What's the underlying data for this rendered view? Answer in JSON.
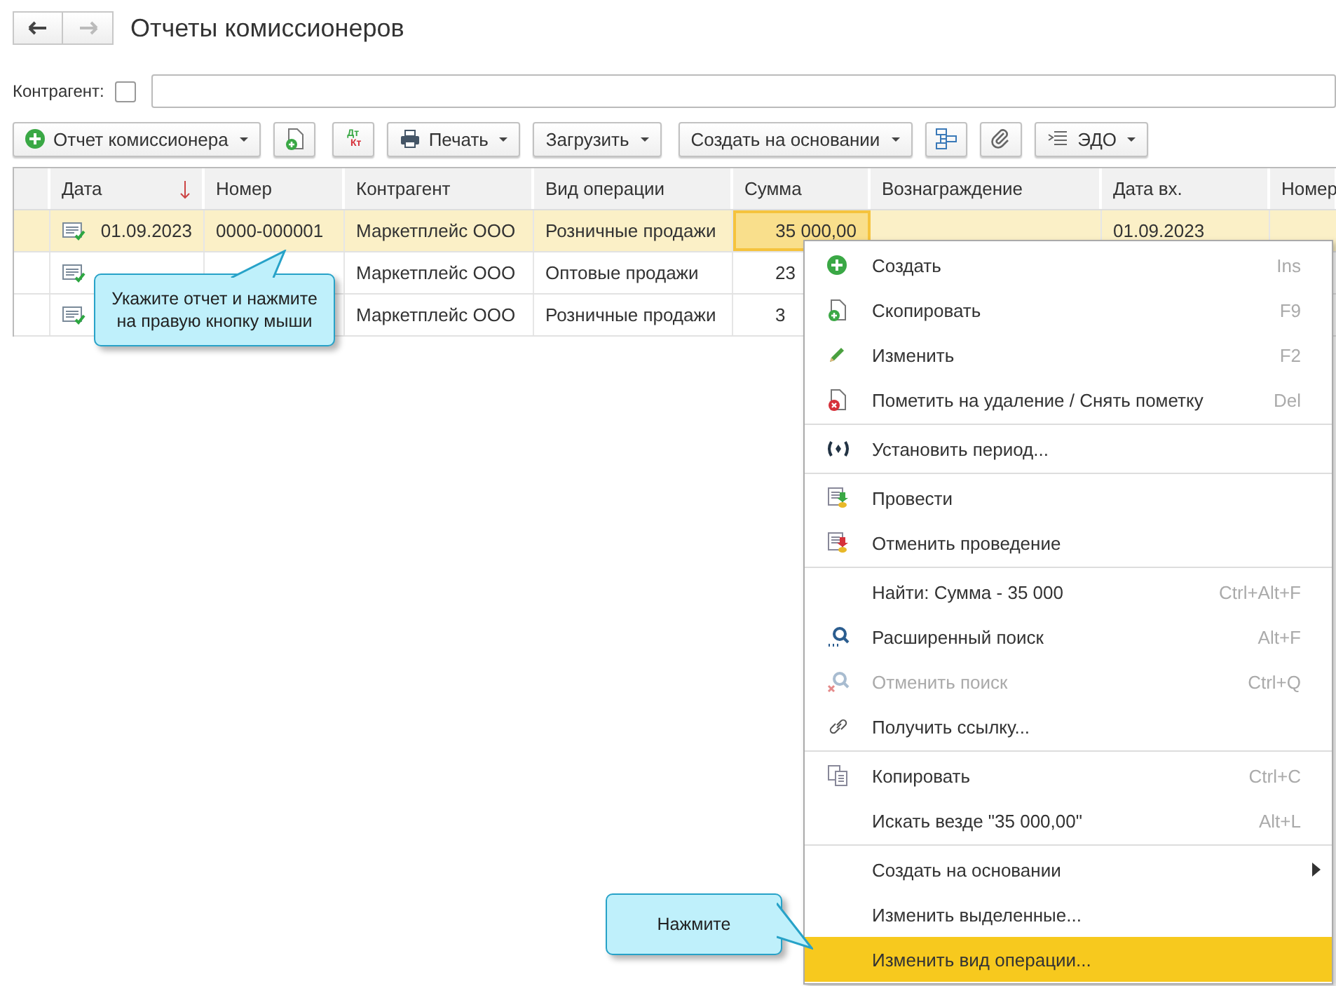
{
  "window": {
    "title": "Отчеты комиссионеров"
  },
  "filter": {
    "label": "Контрагент:",
    "checked": false
  },
  "toolbar": [
    [
      {
        "kind": "addmenu",
        "label": "Отчет комиссионера"
      },
      {
        "kind": "copydoc"
      }
    ],
    [
      {
        "kind": "dtkt",
        "text": [
          "Дт",
          "Кт"
        ]
      },
      {
        "kind": "printmenu",
        "label": "Печать"
      },
      {
        "kind": "menu",
        "label": "Загрузить"
      }
    ],
    [
      {
        "kind": "menu",
        "label": "Создать на основании"
      },
      {
        "kind": "structure"
      },
      {
        "kind": "clip"
      },
      {
        "kind": "edomenu",
        "label": "ЭДО"
      }
    ]
  ],
  "table": {
    "columns": [
      {
        "label": "Дата",
        "sort": true
      },
      {
        "label": "Номер",
        "sort": false
      },
      {
        "label": "Контрагент",
        "sort": false
      },
      {
        "label": "Вид операции",
        "sort": false
      },
      {
        "label": "Сумма",
        "sort": false
      },
      {
        "label": "Вознаграждение",
        "sort": false
      },
      {
        "label": "Дата вх.",
        "sort": false
      },
      {
        "label": "Номер"
      }
    ],
    "rows": [
      {
        "selected": true,
        "posted": true,
        "date": "01.09.2023",
        "number": "0000-000001",
        "counterparty": "Маркетплейс ООО",
        "operation": "Розничные продажи",
        "sum": "35 000,00",
        "sum_clipped": false,
        "date_in": "01.09.2023"
      },
      {
        "selected": false,
        "posted": true,
        "counterparty": "Маркетплейс ООО",
        "operation": "Оптовые продажи",
        "sum": "23",
        "sum_clipped": true
      },
      {
        "selected": false,
        "posted": true,
        "counterparty": "Маркетплейс ООО",
        "operation": "Розничные продажи",
        "sum": "3",
        "sum_clipped": true
      }
    ]
  },
  "context_menu": [
    [
      {
        "kind": "plus",
        "label": "Создать",
        "shortcut": "Ins",
        "disabled": false,
        "selected": false,
        "submenu": false
      },
      {
        "kind": "docplus",
        "label": "Скопировать",
        "shortcut": "F9",
        "disabled": false,
        "selected": false,
        "submenu": false
      },
      {
        "kind": "pencil",
        "label": "Изменить",
        "shortcut": "F2",
        "disabled": false,
        "selected": false,
        "submenu": false
      },
      {
        "kind": "docx",
        "label": "Пометить на удаление / Снять пометку",
        "shortcut": "Del",
        "disabled": false,
        "selected": false,
        "submenu": false
      }
    ],
    [
      {
        "kind": "period",
        "label": "Установить период...",
        "disabled": false,
        "selected": false,
        "submenu": false
      }
    ],
    [
      {
        "kind": "post",
        "label": "Провести",
        "disabled": false,
        "selected": false,
        "submenu": false
      },
      {
        "kind": "unpost",
        "label": "Отменить проведение",
        "disabled": false,
        "selected": false,
        "submenu": false
      }
    ],
    [
      {
        "label": "Найти: Сумма - 35 000",
        "shortcut": "Ctrl+Alt+F",
        "disabled": false,
        "selected": false,
        "submenu": false
      },
      {
        "kind": "search",
        "label": "Расширенный поиск",
        "shortcut": "Alt+F",
        "disabled": false,
        "selected": false,
        "submenu": false
      },
      {
        "kind": "searchx",
        "label": "Отменить поиск",
        "shortcut": "Ctrl+Q",
        "disabled": true,
        "selected": false,
        "submenu": false
      },
      {
        "kind": "link",
        "label": "Получить ссылку...",
        "disabled": false,
        "selected": false,
        "submenu": false
      }
    ],
    [
      {
        "kind": "copy",
        "label": "Копировать",
        "shortcut": "Ctrl+C",
        "disabled": false,
        "selected": false,
        "submenu": false
      },
      {
        "label": "Искать везде \"35 000,00\"",
        "shortcut": "Alt+L",
        "disabled": false,
        "selected": false,
        "submenu": false
      }
    ],
    [
      {
        "label": "Создать на основании",
        "disabled": false,
        "selected": false,
        "submenu": true
      },
      {
        "label": "Изменить выделенные...",
        "disabled": false,
        "selected": false,
        "submenu": false
      },
      {
        "label": "Изменить вид операции...",
        "disabled": false,
        "selected": true,
        "submenu": false
      }
    ]
  ],
  "callouts": [
    {
      "kind": "up",
      "text": "Укажите отчет и нажмите на правую кнопку мыши"
    },
    {
      "kind": "right",
      "text": "Нажмите"
    }
  ]
}
